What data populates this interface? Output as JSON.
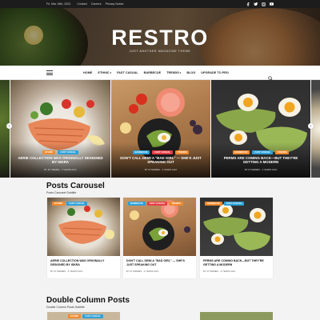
{
  "topbar": {
    "date": "Fri, Mar 18th, 2022",
    "links": [
      "Contact",
      "Careers",
      "Privacy Notice"
    ],
    "socials": [
      "facebook-icon",
      "twitter-icon",
      "instagram-icon",
      "youtube-icon"
    ]
  },
  "site": {
    "logo": "RESTRO",
    "tagline": "JUST ANOTHER MAGAZINE THEME"
  },
  "nav": {
    "items": [
      {
        "label": "HOME",
        "dropdown": false
      },
      {
        "label": "ETHNIC",
        "dropdown": true
      },
      {
        "label": "FAST CASUAL",
        "dropdown": false
      },
      {
        "label": "BARBECUE",
        "dropdown": false
      },
      {
        "label": "TRENDS",
        "dropdown": true
      },
      {
        "label": "BLOG",
        "dropdown": false
      },
      {
        "label": "UPGRADE TO PRO",
        "dropdown": false
      }
    ],
    "dropdown_glyph": "▾",
    "search_icon": "search-icon",
    "menu_icon": "hamburger-icon"
  },
  "slider": {
    "prev": "‹",
    "next": "›",
    "slides": [
      {
        "tags": [
          {
            "label": "ETHNIC",
            "color": "orange"
          },
          {
            "label": "FAST CASUAL",
            "color": "blue"
          }
        ],
        "title": "AERIE COLLECTION WAS ORIGINALLY DESIGNED BY ISKRA",
        "meta": "BY M THEMES  ·  3 YEARS AGO"
      },
      {
        "tags": [
          {
            "label": "BARBECUE",
            "color": "blue"
          },
          {
            "label": "FAST CASUAL",
            "color": "red"
          },
          {
            "label": "TRENDS",
            "color": "orange"
          }
        ],
        "title": "DON'T CALL DEMI A \"BAD GIRL\" — SHE'S JUST SPEAKING OUT",
        "meta": "BY M THEMES  ·  3 YEARS AGO"
      },
      {
        "tags": [
          {
            "label": "BARBECUE",
            "color": "orange"
          },
          {
            "label": "FAST CASUAL",
            "color": "blue"
          },
          {
            "label": "TRENDS",
            "color": "orange"
          }
        ],
        "title": "PERMS ARE COMING BACK—BUT THEY'RE GETTING A MODERN",
        "meta": "BY M THEMES  ·  3 YEARS AGO"
      }
    ]
  },
  "posts_carousel": {
    "title": "Posts Carousel",
    "subtitle": "Posts Carousel Subtitle",
    "cards": [
      {
        "tags": [
          {
            "label": "ETHNIC",
            "color": "orange"
          },
          {
            "label": "FAST CASUAL",
            "color": "blue"
          }
        ],
        "title": "AERIE COLLECTION WAS ORIGINALLY DESIGNED BY ISKRA",
        "meta": "BY M THEMES  ·  3 YEARS AGO"
      },
      {
        "tags": [
          {
            "label": "BARBECUE",
            "color": "blue"
          },
          {
            "label": "FAST CASUAL",
            "color": "red"
          },
          {
            "label": "TRENDS",
            "color": "orange"
          }
        ],
        "title": "DON'T CALL DEMI A \"BAD GIRL\" — SHE'S JUST SPEAKING OUT",
        "meta": "BY M THEMES  ·  3 YEARS AGO"
      },
      {
        "tags": [
          {
            "label": "BARBECUE",
            "color": "orange"
          },
          {
            "label": "FAST CASUAL",
            "color": "blue"
          }
        ],
        "title": "PERMS ARE COMING BACK—BUT THEY'RE GETTING A MODERN",
        "meta": "BY M THEMES  ·  3 YEARS AGO"
      }
    ]
  },
  "double_column": {
    "title": "Double Column Posts",
    "subtitle": "Double Column Posts Subtitle",
    "tags": [
      {
        "label": "ETHNIC",
        "color": "orange"
      },
      {
        "label": "FAST CASUAL",
        "color": "blue"
      }
    ]
  },
  "colors": {
    "orange": "#f18a2e",
    "blue": "#2ea1d8",
    "red": "#e53e46",
    "green": "#5cb85c",
    "topbar": "#1c1c1c"
  }
}
